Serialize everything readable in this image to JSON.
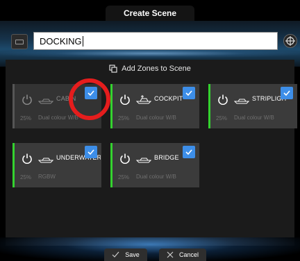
{
  "window": {
    "title": "Create Scene"
  },
  "header": {
    "scene_name": "DOCKING",
    "keyboard_icon": "keyboard-icon",
    "target_icon": "crosshair-icon"
  },
  "add_zones_label": "Add Zones to Scene",
  "zones": [
    {
      "name": "CABIN",
      "level": "25%",
      "description": "Dual colour W/B",
      "checked": true,
      "active": false
    },
    {
      "name": "COCKPIT",
      "level": "25%",
      "description": "Dual colour W/B",
      "checked": true,
      "active": true
    },
    {
      "name": "STRIPLIGHT",
      "level": "25%",
      "description": "Dual colour W/B",
      "checked": true,
      "active": true
    },
    {
      "name": "UNDERWATER",
      "level": "25%",
      "description": "RGBW",
      "checked": true,
      "active": true
    },
    {
      "name": "BRIDGE",
      "level": "25%",
      "description": "Dual colour W/B",
      "checked": true,
      "active": true
    }
  ],
  "footer": {
    "save_label": "Save",
    "cancel_label": "Cancel"
  },
  "colors": {
    "accent": "#3d8ee8",
    "active_bar": "#34d22f",
    "highlight_ring": "#e51d1d"
  }
}
